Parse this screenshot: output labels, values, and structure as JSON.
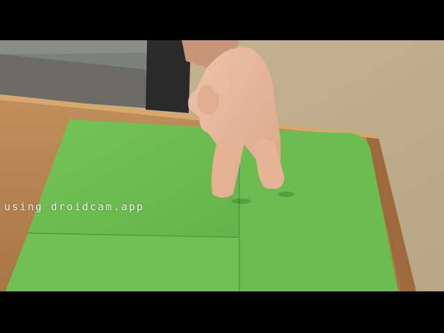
{
  "watermark": {
    "text": "using droidcam.app"
  },
  "colors": {
    "letterbox": "#000000",
    "paper_green": "#6fbf52",
    "table_wood": "#b98a57",
    "carpet": "#c9b79a",
    "skin": "#e6b59a"
  }
}
